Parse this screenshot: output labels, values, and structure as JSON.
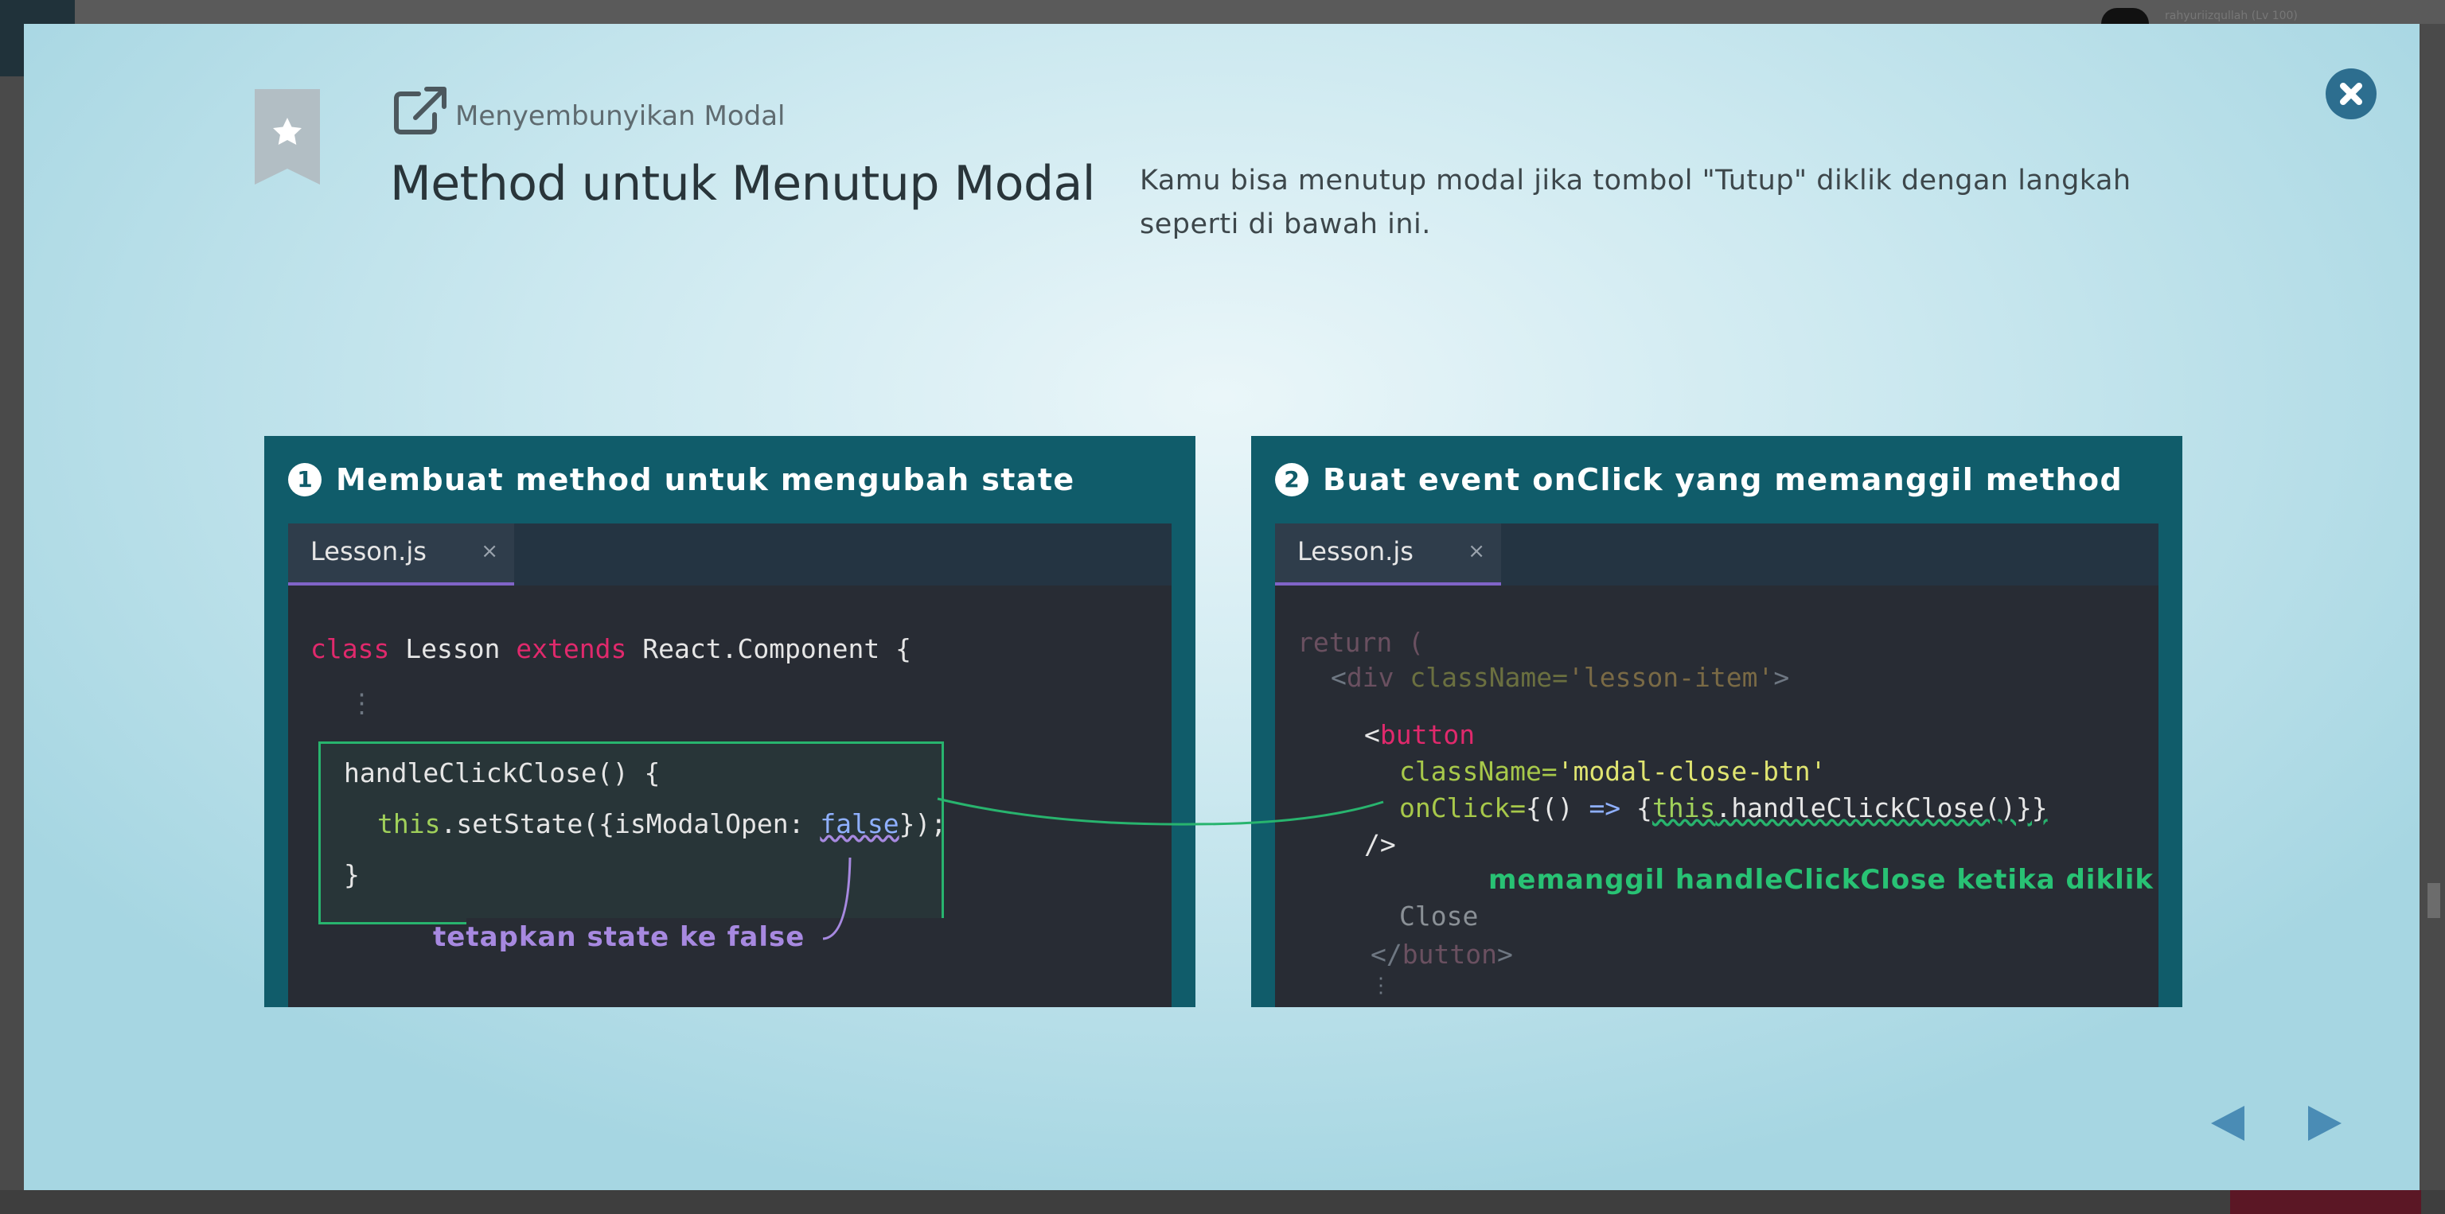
{
  "background": {
    "user_label": "rahyuriizqullah (Lv 100)"
  },
  "modal": {
    "subtitle": "Menyembunyikan Modal",
    "title": "Method untuk Menutup Modal",
    "description": "Kamu bisa menutup modal jika tombol \"Tutup\" diklik dengan langkah seperti di bawah ini.",
    "close_icon": "close-icon",
    "bookmark_icon": "star-bookmark-icon",
    "link_icon": "external-link-icon",
    "accent_color": "#2d6e8f"
  },
  "panels": [
    {
      "number": "1",
      "title": "Membuat method untuk mengubah state",
      "tab": "Lesson.js",
      "tab_close": "×",
      "code": {
        "l1_kw1": "class",
        "l1_a": " Lesson ",
        "l1_kw2": "extends",
        "l1_b": " React.Component {",
        "l2": "⋮",
        "l3": "handleClickClose() {",
        "l4_this": "this",
        "l4_a": ".setState({isModalOpen: ",
        "l4_false": "false",
        "l4_b": "});",
        "l5": "}"
      },
      "annotation": "tetapkan state ke false"
    },
    {
      "number": "2",
      "title": "Buat event onClick yang memanggil method",
      "tab": "Lesson.js",
      "tab_close": "×",
      "code": {
        "l1": "return (",
        "l2_a": "<",
        "l2_div": "div",
        "l2_attr": " className=",
        "l2_val": "'lesson-item'",
        "l2_b": ">",
        "l3_a": "<",
        "l3_button": "button",
        "l4_attr": "className=",
        "l4_val": "'modal-close-btn'",
        "l5_attr": "onClick=",
        "l5_a": "{() ",
        "l5_arrow": "=>",
        "l5_b": " {",
        "l5_this": "this",
        "l5_c": ".handleClickClose()}}",
        "l6": "/>",
        "l7": "Close",
        "l8_a": "</",
        "l8_button": "button",
        "l8_b": ">",
        "l9": "⋮"
      },
      "annotation": "memanggil handleClickClose ketika diklik"
    }
  ],
  "navigation": {
    "prev_icon": "arrow-left-icon",
    "next_icon": "arrow-right-icon"
  }
}
